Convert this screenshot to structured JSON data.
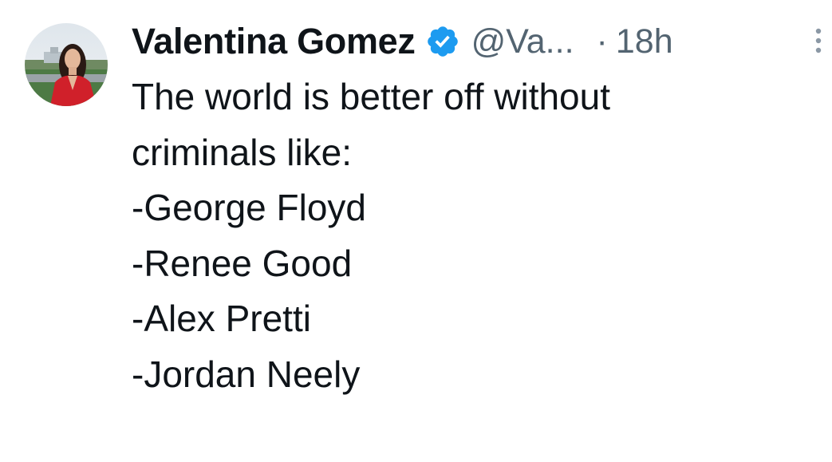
{
  "tweet": {
    "display_name": "Valentina Gomez",
    "handle": "@Va...",
    "separator": "·",
    "timestamp": "18h",
    "verified_icon": "verified-badge-icon",
    "verified_color": "#1d9bf0",
    "more_icon": "more-vertical-icon",
    "avatar_icon": "profile-avatar",
    "text_lines": [
      "The world is better off without",
      "criminals like:",
      "-George Floyd",
      "-Renee Good",
      "-Alex Pretti",
      "-Jordan Neely"
    ]
  }
}
